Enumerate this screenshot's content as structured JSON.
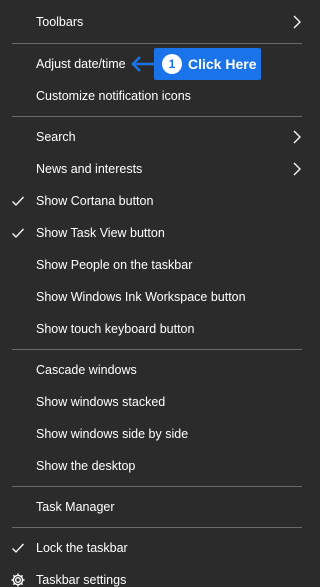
{
  "menu": {
    "toolbars": "Toolbars",
    "adjust_date_time": "Adjust date/time",
    "customize_notification_icons": "Customize notification icons",
    "search": "Search",
    "news_and_interests": "News and interests",
    "show_cortana_button": "Show Cortana button",
    "show_task_view_button": "Show Task View button",
    "show_people": "Show People on the taskbar",
    "show_ink_workspace": "Show Windows Ink Workspace button",
    "show_touch_keyboard": "Show touch keyboard button",
    "cascade_windows": "Cascade windows",
    "show_windows_stacked": "Show windows stacked",
    "show_windows_side_by_side": "Show windows side by side",
    "show_the_desktop": "Show the desktop",
    "task_manager": "Task Manager",
    "lock_the_taskbar": "Lock the taskbar",
    "taskbar_settings": "Taskbar settings"
  },
  "checked": {
    "show_cortana_button": true,
    "show_task_view_button": true,
    "lock_the_taskbar": true
  },
  "annotation": {
    "step_number": "1",
    "text": "Click Here"
  },
  "icons": {
    "submenu": "chevron-right-icon",
    "checked": "checkmark-icon",
    "settings": "gear-icon",
    "pointer": "arrow-left-icon"
  },
  "colors": {
    "menu_background": "#2b2b2b",
    "text": "#ffffff",
    "separator": "#6a6a6a",
    "annotation_accent": "#1a73e8"
  }
}
